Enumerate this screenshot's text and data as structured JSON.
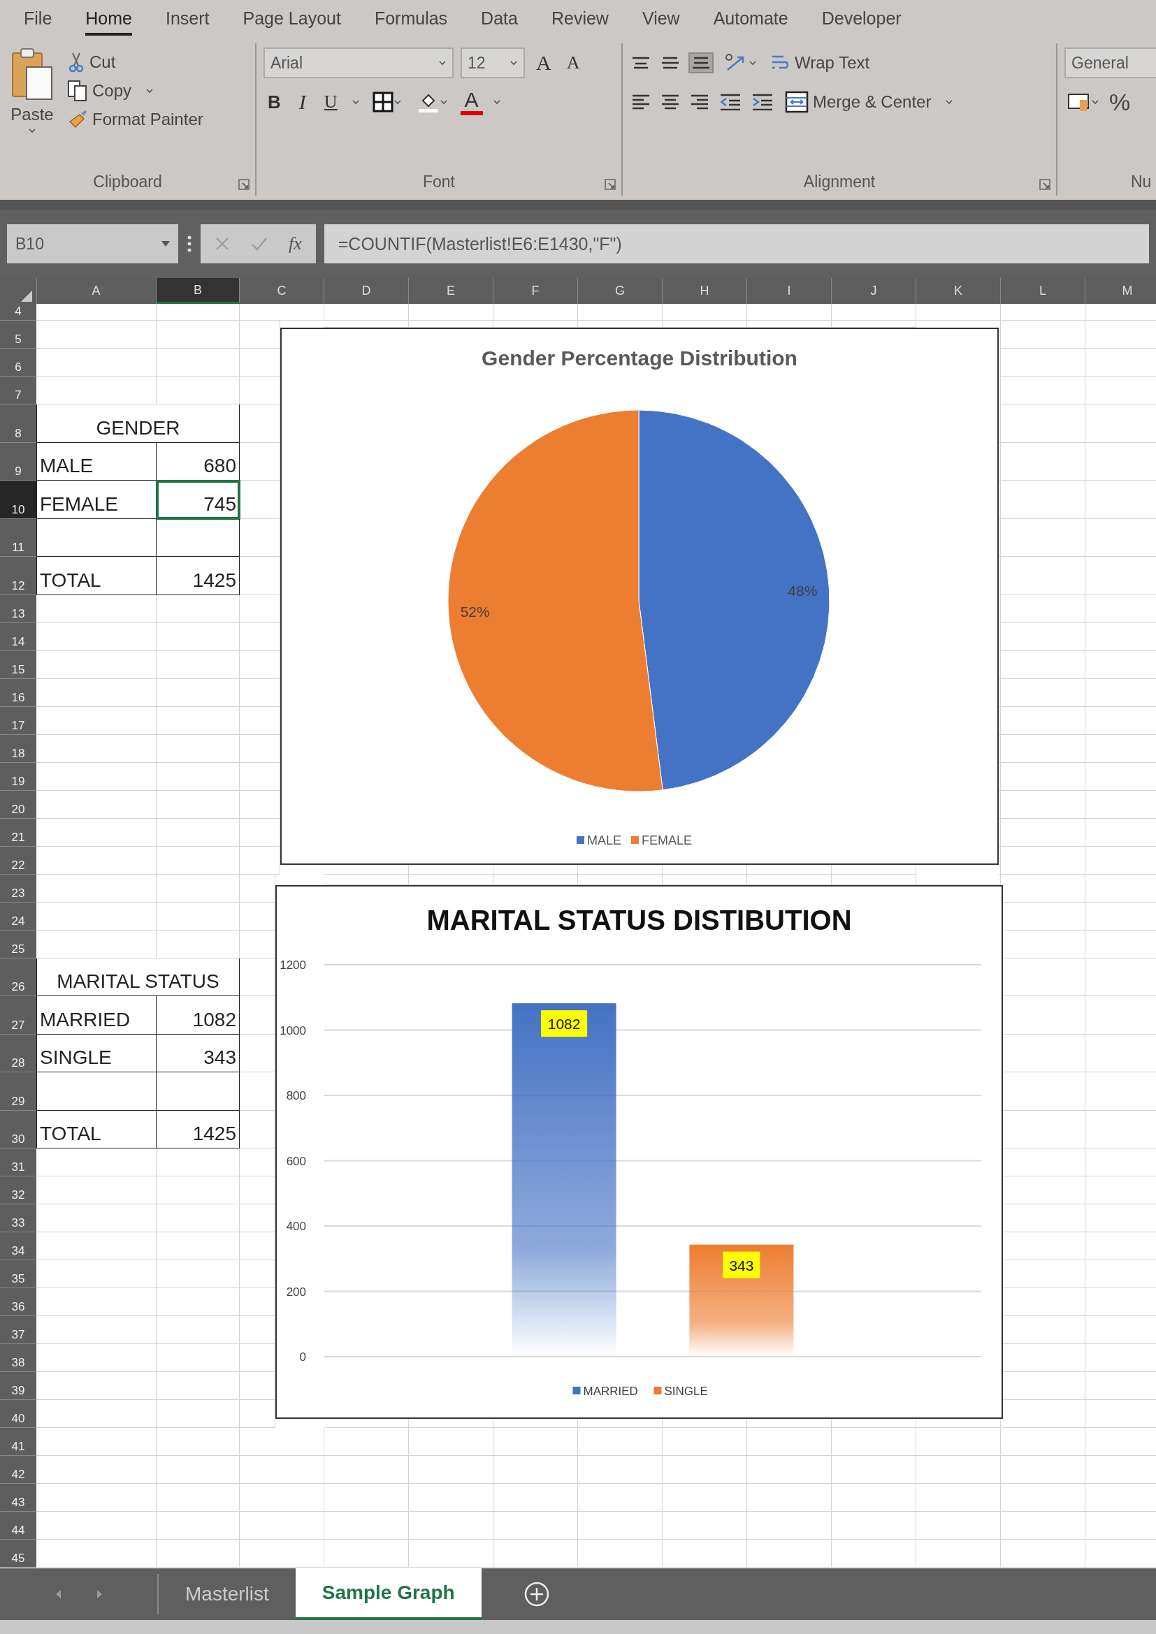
{
  "ribbon_tabs": [
    {
      "label": "File",
      "selected": false
    },
    {
      "label": "Home",
      "selected": true
    },
    {
      "label": "Insert",
      "selected": false
    },
    {
      "label": "Page Layout",
      "selected": false
    },
    {
      "label": "Formulas",
      "selected": false
    },
    {
      "label": "Data",
      "selected": false
    },
    {
      "label": "Review",
      "selected": false
    },
    {
      "label": "View",
      "selected": false
    },
    {
      "label": "Automate",
      "selected": false
    },
    {
      "label": "Developer",
      "selected": false
    }
  ],
  "clipboard": {
    "paste": "Paste",
    "cut": "Cut",
    "copy": "Copy",
    "format_painter": "Format Painter",
    "label": "Clipboard"
  },
  "font": {
    "name": "Arial",
    "size": "12",
    "grow": "A",
    "shrink": "A",
    "bold": "B",
    "italic": "I",
    "underline": "U",
    "font_color": "A",
    "label": "Font"
  },
  "alignment": {
    "vertical": [
      {
        "kind": "top",
        "selected": false
      },
      {
        "kind": "middle",
        "selected": false
      },
      {
        "kind": "bottom",
        "selected": true
      }
    ],
    "wrap_text": "Wrap Text",
    "merge": "Merge & Center",
    "label": "Alignment"
  },
  "number": {
    "format": "General",
    "percent": "%",
    "label": "Nu"
  },
  "formula_bar": {
    "name_box": "B10",
    "fx": "fx",
    "formula": "=COUNTIF(Masterlist!E6:E1430,\"F\")"
  },
  "sheet": {
    "columns": [
      {
        "label": "A",
        "selected": false
      },
      {
        "label": "B",
        "selected": true
      },
      {
        "label": "C",
        "selected": false
      },
      {
        "label": "D",
        "selected": false
      },
      {
        "label": "E",
        "selected": false
      },
      {
        "label": "F",
        "selected": false
      },
      {
        "label": "G",
        "selected": false
      },
      {
        "label": "H",
        "selected": false
      },
      {
        "label": "I",
        "selected": false
      },
      {
        "label": "J",
        "selected": false
      },
      {
        "label": "K",
        "selected": false
      },
      {
        "label": "L",
        "selected": false
      },
      {
        "label": "M",
        "selected": false
      }
    ],
    "rows": [
      {
        "label": "4",
        "selected": false,
        "boxed": false
      },
      {
        "label": "5",
        "selected": false,
        "boxed": false
      },
      {
        "label": "6",
        "selected": false,
        "boxed": false
      },
      {
        "label": "7",
        "selected": false,
        "boxed": false
      },
      {
        "label": "8",
        "selected": false,
        "boxed": true,
        "cells": [
          {
            "text": "GENDER",
            "kind": "merged",
            "selected": false
          }
        ]
      },
      {
        "label": "9",
        "selected": false,
        "boxed": true,
        "cells": [
          {
            "text": "MALE",
            "kind": "label",
            "selected": false
          },
          {
            "text": "680",
            "kind": "number",
            "selected": false
          }
        ]
      },
      {
        "label": "10",
        "selected": true,
        "boxed": true,
        "cells": [
          {
            "text": "FEMALE",
            "kind": "label",
            "selected": false
          },
          {
            "text": "745",
            "kind": "number",
            "selected": true
          }
        ]
      },
      {
        "label": "11",
        "selected": false,
        "boxed": true
      },
      {
        "label": "12",
        "selected": false,
        "boxed": true,
        "cells": [
          {
            "text": "TOTAL",
            "kind": "label",
            "selected": false
          },
          {
            "text": "1425",
            "kind": "number",
            "selected": false
          }
        ]
      },
      {
        "label": "13",
        "selected": false,
        "boxed": false
      },
      {
        "label": "14",
        "selected": false,
        "boxed": false
      },
      {
        "label": "15",
        "selected": false,
        "boxed": false
      },
      {
        "label": "16",
        "selected": false,
        "boxed": false
      },
      {
        "label": "17",
        "selected": false,
        "boxed": false
      },
      {
        "label": "18",
        "selected": false,
        "boxed": false
      },
      {
        "label": "19",
        "selected": false,
        "boxed": false
      },
      {
        "label": "20",
        "selected": false,
        "boxed": false
      },
      {
        "label": "21",
        "selected": false,
        "boxed": false
      },
      {
        "label": "22",
        "selected": false,
        "boxed": false
      },
      {
        "label": "23",
        "selected": false,
        "boxed": false
      },
      {
        "label": "24",
        "selected": false,
        "boxed": false
      },
      {
        "label": "25",
        "selected": false,
        "boxed": false
      },
      {
        "label": "26",
        "selected": false,
        "boxed": true,
        "cells": [
          {
            "text": "MARITAL STATUS",
            "kind": "merged",
            "selected": false
          }
        ]
      },
      {
        "label": "27",
        "selected": false,
        "boxed": true,
        "cells": [
          {
            "text": "MARRIED",
            "kind": "label",
            "selected": false
          },
          {
            "text": "1082",
            "kind": "number",
            "selected": false
          }
        ]
      },
      {
        "label": "28",
        "selected": false,
        "boxed": true,
        "cells": [
          {
            "text": "SINGLE",
            "kind": "label",
            "selected": false
          },
          {
            "text": "343",
            "kind": "number",
            "selected": false
          }
        ]
      },
      {
        "label": "29",
        "selected": false,
        "boxed": true
      },
      {
        "label": "30",
        "selected": false,
        "boxed": true,
        "cells": [
          {
            "text": "TOTAL",
            "kind": "label",
            "selected": false
          },
          {
            "text": "1425",
            "kind": "number",
            "selected": false
          }
        ]
      },
      {
        "label": "31",
        "selected": false,
        "boxed": false
      },
      {
        "label": "32",
        "selected": false,
        "boxed": false
      },
      {
        "label": "33",
        "selected": false,
        "boxed": false
      },
      {
        "label": "34",
        "selected": false,
        "boxed": false
      },
      {
        "label": "35",
        "selected": false,
        "boxed": false
      },
      {
        "label": "36",
        "selected": false,
        "boxed": false
      },
      {
        "label": "37",
        "selected": false,
        "boxed": false
      },
      {
        "label": "38",
        "selected": false,
        "boxed": false
      },
      {
        "label": "39",
        "selected": false,
        "boxed": false
      },
      {
        "label": "40",
        "selected": false,
        "boxed": false
      },
      {
        "label": "41",
        "selected": false,
        "boxed": false
      },
      {
        "label": "42",
        "selected": false,
        "boxed": false
      },
      {
        "label": "43",
        "selected": false,
        "boxed": false
      },
      {
        "label": "44",
        "selected": false,
        "boxed": false
      },
      {
        "label": "45",
        "selected": false,
        "boxed": false
      }
    ]
  },
  "charts": [
    {
      "chart_data": {
        "type": "pie",
        "title": "Gender Percentage Distribution",
        "categories": [
          "MALE",
          "FEMALE"
        ],
        "values": [
          48,
          52
        ],
        "colors": [
          "#4472c4",
          "#ed7d31"
        ],
        "value_labels": [
          "48%",
          "52%"
        ],
        "legend": true
      }
    },
    {
      "chart_data": {
        "type": "bar",
        "title": "MARITAL STATUS DISTIBUTION",
        "series": [
          {
            "name": "MARRIED",
            "color": "#4472c4",
            "values": [
              1082
            ]
          },
          {
            "name": "SINGLE",
            "color": "#ed7d31",
            "values": [
              343
            ]
          }
        ],
        "ylim": [
          0,
          1200
        ],
        "yticks": [
          0,
          200,
          400,
          600,
          800,
          1000,
          1200
        ],
        "grid": true,
        "value_labels": [
          "1082",
          "343"
        ],
        "legend": true
      }
    }
  ],
  "sheet_tabs": [
    {
      "label": "Masterlist",
      "selected": false
    },
    {
      "label": "Sample Graph",
      "selected": true
    }
  ]
}
